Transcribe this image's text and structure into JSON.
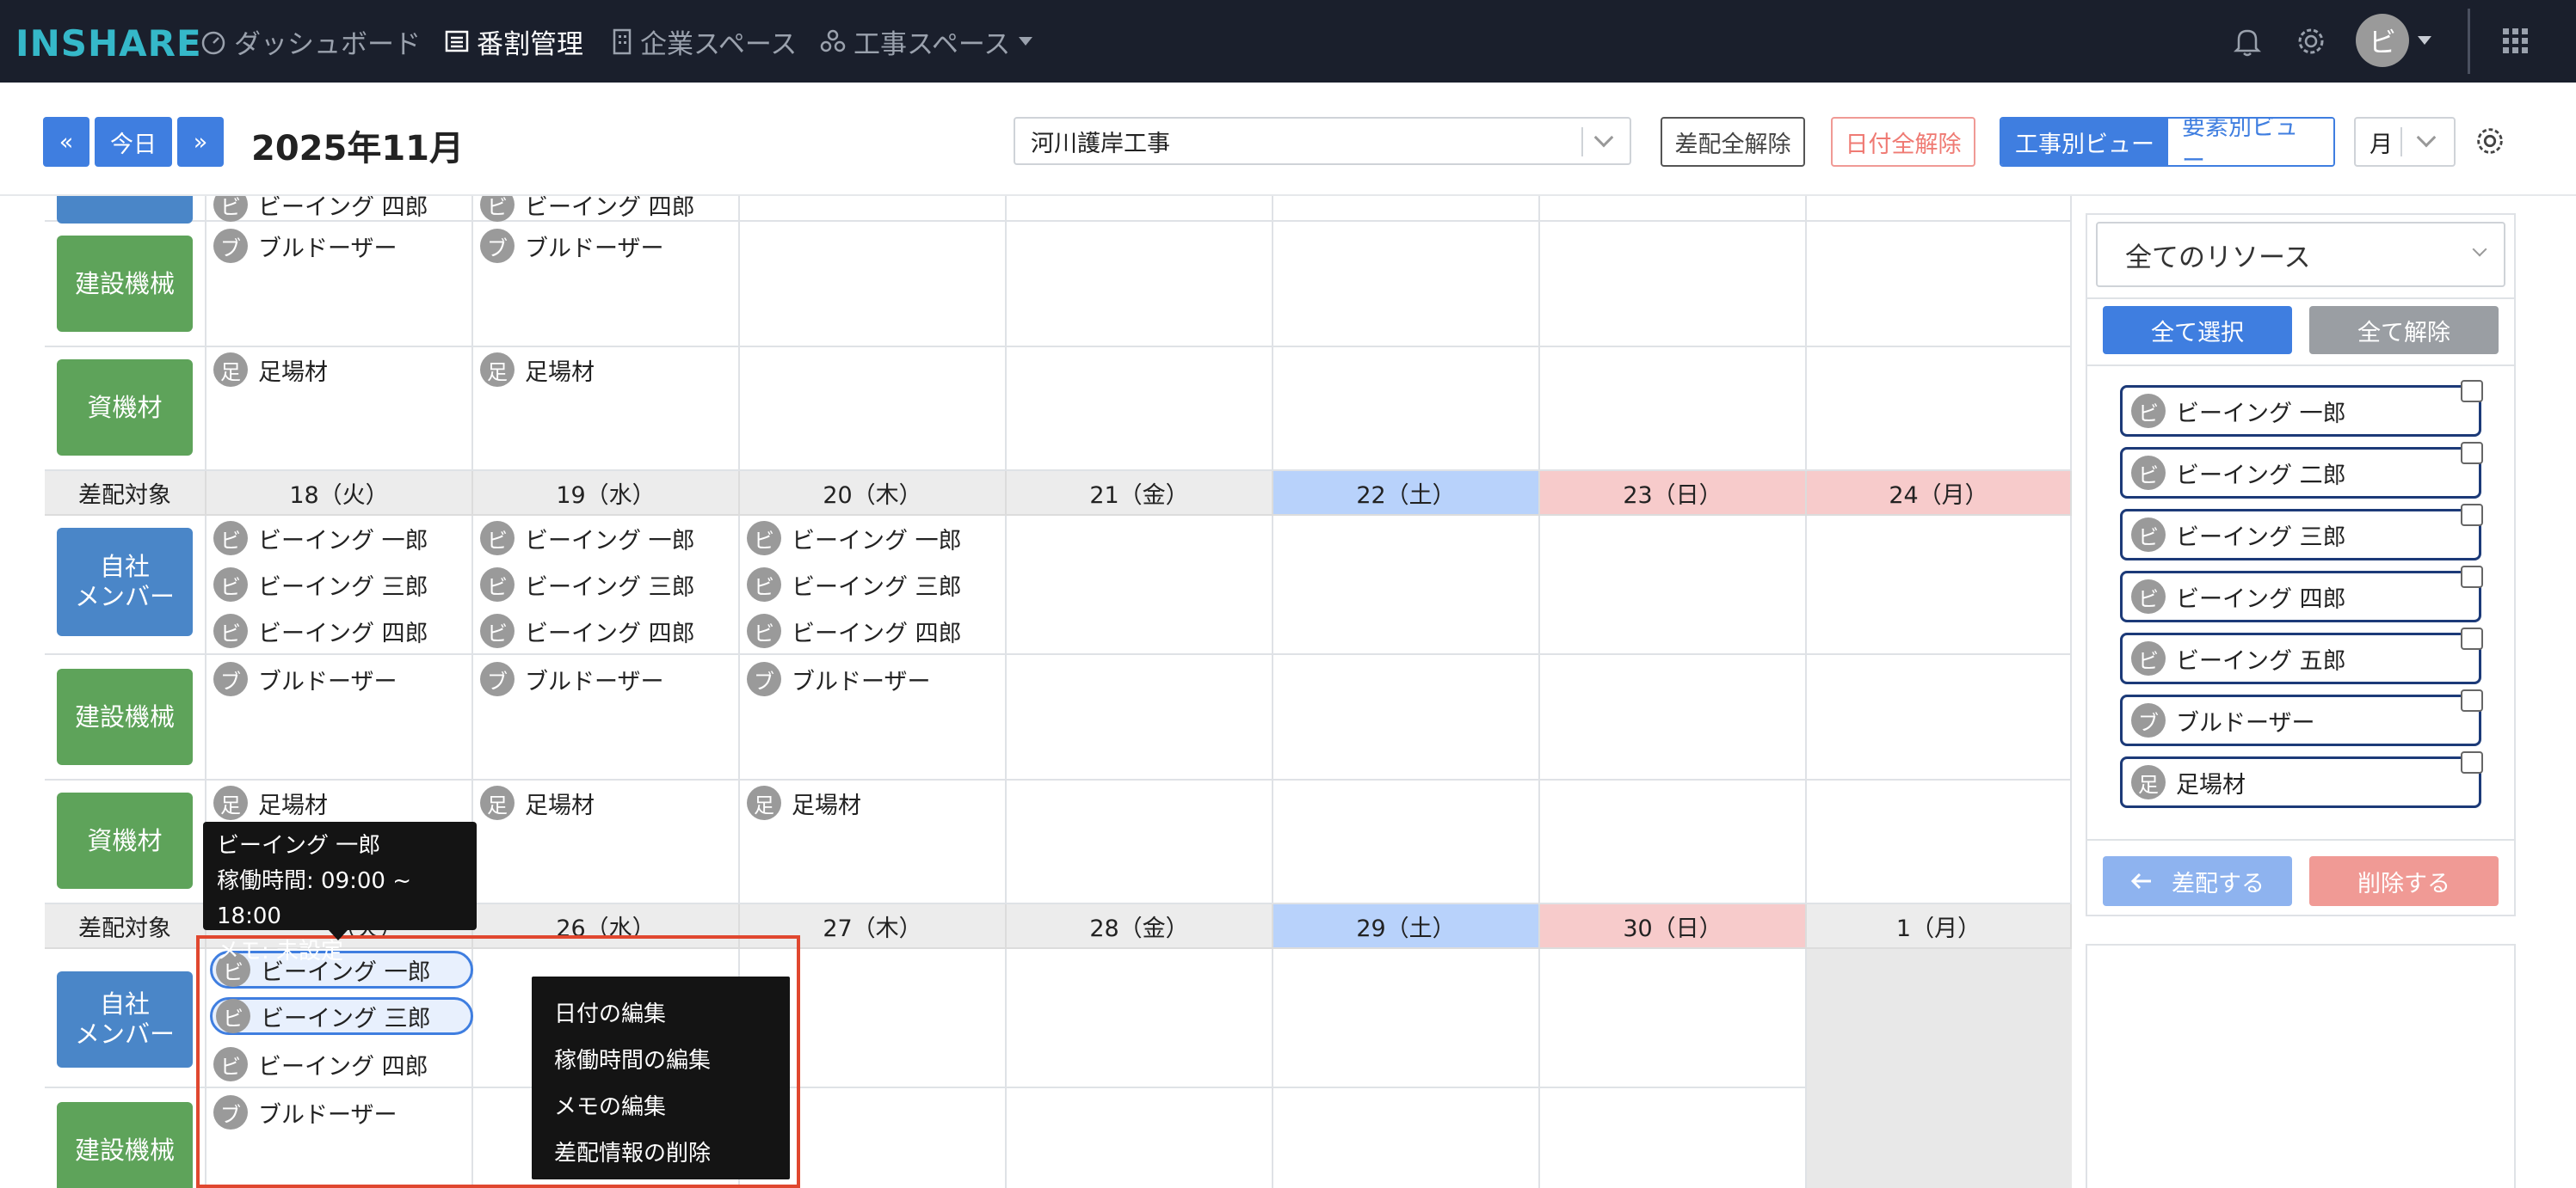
{
  "nav": {
    "logo": "INSHARE",
    "items": [
      {
        "label": "ダッシュボード"
      },
      {
        "label": "番割管理"
      },
      {
        "label": "企業スペース"
      },
      {
        "label": "工事スペース"
      }
    ],
    "avatar": "ビ"
  },
  "toolbar": {
    "prev": "«",
    "today": "今日",
    "next": "»",
    "month_title": "2025年11月",
    "project": "河川護岸工事",
    "clear_assign": "差配全解除",
    "clear_dates": "日付全解除",
    "view_by_project": "工事別ビュー",
    "view_by_element": "要素別ビュー",
    "period": "月"
  },
  "calendar": {
    "header_label": "差配対象",
    "categories": {
      "members": "自社\nメンバー",
      "machines": "建設機械",
      "materials": "資機材"
    },
    "partial_chips": [
      "ビーイング 四郎",
      "ビーイング 四郎"
    ],
    "week_prev": {
      "machines": [
        "ブルドーザー",
        "ブルドーザー"
      ],
      "materials": [
        "足場材",
        "足場材"
      ]
    },
    "week2": {
      "days": [
        "18（火）",
        "19（水）",
        "20（木）",
        "21（金）",
        "22（土）",
        "23（日）",
        "24（月）"
      ],
      "members": [
        [
          "ビーイング 一郎",
          "ビーイング 三郎",
          "ビーイング 四郎"
        ],
        [
          "ビーイング 一郎",
          "ビーイング 三郎",
          "ビーイング 四郎"
        ],
        [
          "ビーイング 一郎",
          "ビーイング 三郎",
          "ビーイング 四郎"
        ]
      ],
      "machines": [
        "ブルドーザー",
        "ブルドーザー",
        "ブルドーザー"
      ],
      "materials": [
        "足場材",
        "足場材",
        "足場材"
      ]
    },
    "week3": {
      "days": [
        "（火）",
        "26（水）",
        "27（木）",
        "28（金）",
        "29（土）",
        "30（日）",
        "1（月）"
      ],
      "members": [
        "ビーイング 一郎",
        "ビーイング 三郎",
        "ビーイング 四郎"
      ],
      "machines": [
        "ブルドーザー"
      ]
    },
    "chip_initials": {
      "member": "ビ",
      "machine": "ブ",
      "material": "足"
    }
  },
  "tooltip": {
    "name": "ビーイング 一郎",
    "hours": "稼働時間: 09:00 ~ 18:00",
    "memo": "メモ: 未設定"
  },
  "context_menu": [
    "日付の編集",
    "稼働時間の編集",
    "メモの編集",
    "差配情報の削除"
  ],
  "sidebar": {
    "filter": "全てのリソース",
    "select_all": "全て選択",
    "deselect_all": "全て解除",
    "resources": [
      {
        "initial": "ビ",
        "name": "ビーイング 一郎"
      },
      {
        "initial": "ビ",
        "name": "ビーイング 二郎"
      },
      {
        "initial": "ビ",
        "name": "ビーイング 三郎"
      },
      {
        "initial": "ビ",
        "name": "ビーイング 四郎"
      },
      {
        "initial": "ビ",
        "name": "ビーイング 五郎"
      },
      {
        "initial": "ブ",
        "name": "ブルドーザー"
      },
      {
        "initial": "足",
        "name": "足場材"
      }
    ],
    "assign": "差配する",
    "delete": "削除する"
  },
  "colors": {
    "nav_bg": "#1a1f2c",
    "primary": "#3f7ee0",
    "danger": "#e0472f",
    "green": "#5ea35a",
    "saturday": "#b8d2fb",
    "sunday": "#f7cbcb"
  },
  "icons": [
    "dashboard-icon",
    "list-icon",
    "building-icon",
    "network-icon",
    "bell-icon",
    "gear-icon",
    "apps-grid-icon",
    "settings-icon",
    "arrow-left-icon"
  ]
}
